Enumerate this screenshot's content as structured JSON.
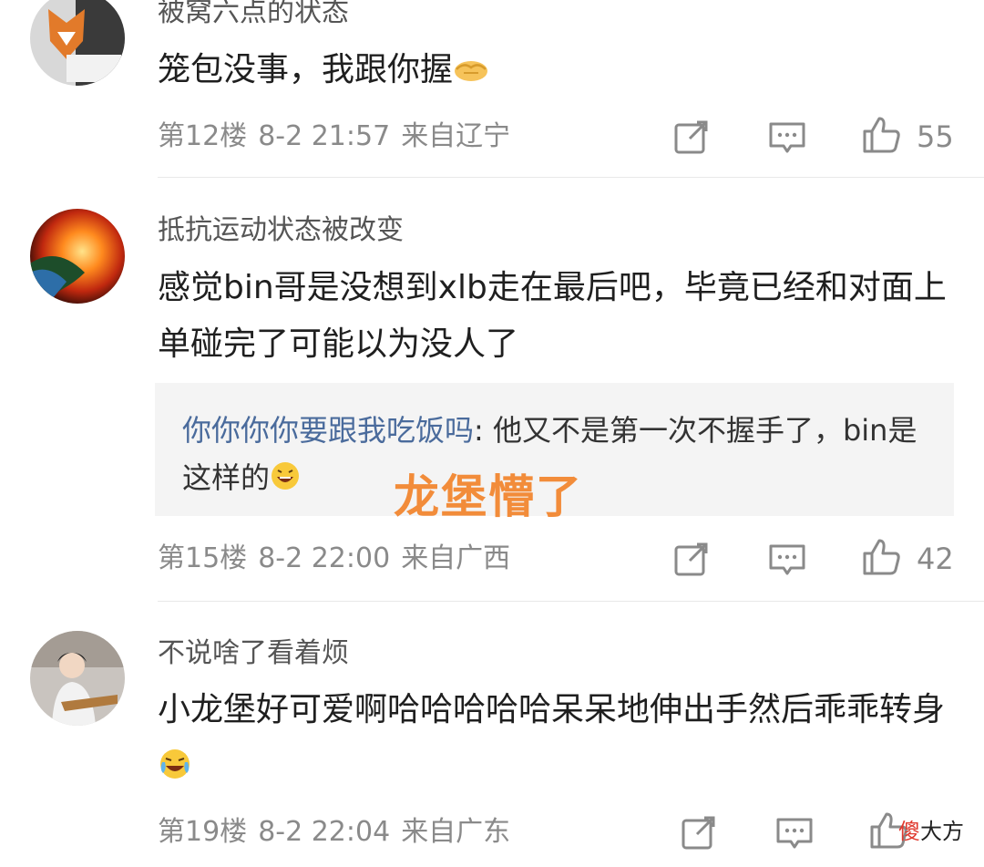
{
  "comments": [
    {
      "username": "被窝六点的状态",
      "text": "笼包没事，我跟你握",
      "floor": "第12楼",
      "time": "8-2 21:57",
      "location": "来自辽宁",
      "likes": "55",
      "emoji": "handshake"
    },
    {
      "username": "抵抗运动状态被改变",
      "text": "感觉bin哥是没想到xlb走在最后吧，毕竟已经和对面上单碰完了可能以为没人了",
      "reply": {
        "user": "你你你你要跟我吃饭吗",
        "text": ": 他又不是第一次不握手了，bin是这样的"
      },
      "floor": "第15楼",
      "time": "8-2 22:00",
      "location": "来自广西",
      "likes": "42"
    },
    {
      "username": "不说啥了看着烦",
      "text": "小龙堡好可爱啊哈哈哈哈哈呆呆地伸出手然后乖乖转身",
      "floor": "第19楼",
      "time": "8-2 22:04",
      "location": "来自广东",
      "likes": ""
    }
  ],
  "overlay": {
    "caption": "龙堡懵了"
  },
  "watermark": {
    "part1": "傻",
    "part2": "大方"
  },
  "colors": {
    "reply_user": "#4a6b9c",
    "overlay": "#f28c3a",
    "meta": "#8a8a8a",
    "divider": "#e8e8e8"
  },
  "icons": [
    "share-icon",
    "reply-icon",
    "like-icon",
    "handshake-emoji",
    "grin-emoji",
    "laugh-cry-emoji"
  ]
}
